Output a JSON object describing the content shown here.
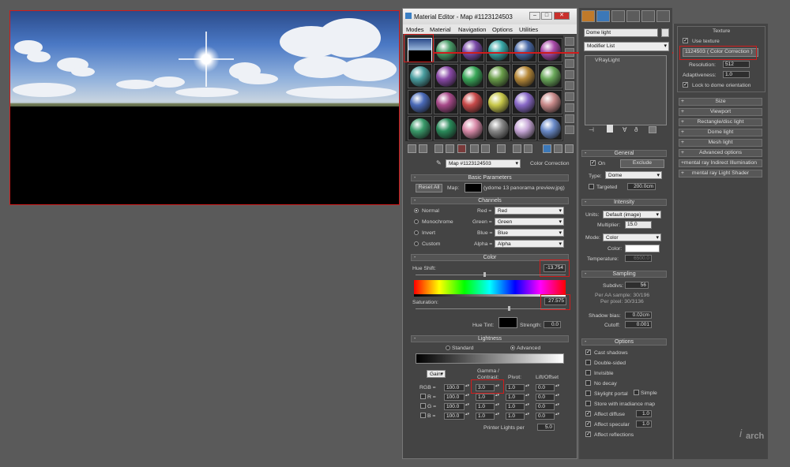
{
  "panorama": {
    "description_icon": "hdr-sky-dome-preview"
  },
  "material_editor": {
    "title": "Material Editor - Map #1123124503",
    "menus": [
      "Modes",
      "Material",
      "Navigation",
      "Options",
      "Utilities"
    ],
    "map_name": "Map #1123124503",
    "map_type": "Color Correction",
    "basic_parameters": {
      "header": "Basic Parameters",
      "reset_all": "Reset All",
      "map_label": "Map:",
      "map_file": "(ydome 13 panorama preview.jpg)"
    },
    "channels": {
      "header": "Channels",
      "modes": [
        "Normal",
        "Monochrome",
        "Invert",
        "Custom"
      ],
      "rows": [
        {
          "label": "Red =",
          "value": "Red"
        },
        {
          "label": "Green =",
          "value": "Green"
        },
        {
          "label": "Blue =",
          "value": "Blue"
        },
        {
          "label": "Alpha =",
          "value": "Alpha"
        }
      ]
    },
    "color": {
      "header": "Color",
      "hue_shift_label": "Hue Shift:",
      "hue_shift": "-13.754",
      "saturation_label": "Saturation:",
      "saturation": "27.575",
      "hue_tint_label": "Hue Tint:",
      "strength_label": "Strength:",
      "strength": "0.0"
    },
    "lightness": {
      "header": "Lightness",
      "standard": "Standard",
      "advanced": "Advanced",
      "gain_mode": "Gain:",
      "col_gamma": "Gamma /",
      "col_contrast": "Contrast:",
      "col_pivot": "Pivot:",
      "col_lift": "Lift/Offset",
      "rows": [
        {
          "label": "RGB =",
          "gain": "100.0",
          "gamma": "3.0",
          "pivot": "1.0",
          "lift": "0.0"
        },
        {
          "label": "R =",
          "gain": "100.0",
          "gamma": "1.0",
          "pivot": "1.0",
          "lift": "0.0"
        },
        {
          "label": "G =",
          "gain": "100.0",
          "gamma": "1.0",
          "pivot": "1.0",
          "lift": "0.0"
        },
        {
          "label": "B =",
          "gain": "100.0",
          "gamma": "1.0",
          "pivot": "1.0",
          "lift": "0.0"
        }
      ],
      "printer_lights_label": "Printer Lights per",
      "printer_lights": "5.0"
    }
  },
  "command_panel": {
    "object_name": "Dome light",
    "modifier_list": "Modifier List",
    "stack_item": "VRayLight",
    "general": {
      "header": "General",
      "on": "On",
      "exclude": "Exclude",
      "type_label": "Type:",
      "type": "Dome",
      "targeted": "Targeted",
      "target_dist": "200.0cm"
    },
    "intensity": {
      "header": "Intensity",
      "units_label": "Units:",
      "units": "Default (image)",
      "multiplier_label": "Multiplier:",
      "multiplier": "15.0",
      "mode_label": "Mode:",
      "mode": "Color",
      "color_label": "Color:",
      "temperature_label": "Temperature:",
      "temperature": "6500.0"
    },
    "sampling": {
      "header": "Sampling",
      "subdivs_label": "Subdivs:",
      "subdivs": "56",
      "per_aa": "Per AA sample: 30/196",
      "per_pixel": "Per pixel: 30/3136",
      "shadow_bias_label": "Shadow bias:",
      "shadow_bias": "0.02cm",
      "cutoff_label": "Cutoff:",
      "cutoff": "0.001"
    },
    "options": {
      "header": "Options",
      "items": [
        {
          "label": "Cast shadows",
          "checked": true
        },
        {
          "label": "Double-sided",
          "checked": false
        },
        {
          "label": "Invisible",
          "checked": false
        },
        {
          "label": "No decay",
          "checked": false
        },
        {
          "label": "Skylight portal",
          "checked": false
        },
        {
          "label": "Store with irradiance map",
          "checked": false
        },
        {
          "label": "Affect diffuse",
          "checked": true
        },
        {
          "label": "Affect specular",
          "checked": true
        },
        {
          "label": "Affect reflections",
          "checked": true
        }
      ],
      "simple": "Simple",
      "affect_diffuse_val": "1.0",
      "affect_specular_val": "1.0"
    }
  },
  "right_panel": {
    "texture_header": "Texture",
    "use_texture": "Use texture",
    "texture_map": "1124503  ( Color Correction )",
    "resolution_label": "Resolution:",
    "resolution": "512",
    "adaptiveness_label": "Adaptiveness:",
    "adaptiveness": "1.0",
    "lock_dome": "Lock to dome orientation",
    "rollouts": [
      "Size",
      "Viewport",
      "Rectangle/disc light",
      "Dome light",
      "Mesh light",
      "Advanced options",
      "mental ray Indirect Illumination",
      "mental ray Light Shader"
    ]
  }
}
